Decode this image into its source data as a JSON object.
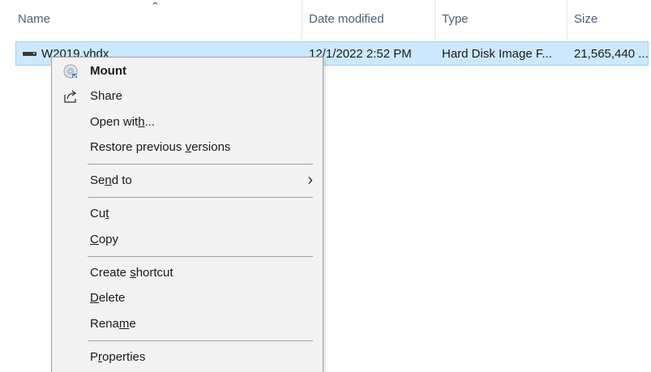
{
  "columns": {
    "name": "Name",
    "date_modified": "Date modified",
    "type": "Type",
    "size": "Size"
  },
  "file": {
    "name": "W2019.vhdx",
    "date_modified": "12/1/2022 2:52 PM",
    "type": "Hard Disk Image F...",
    "size": "21,565,440 ..."
  },
  "context_menu": {
    "mount": "Mount",
    "share": "Share",
    "open_with_pre": "Open wit",
    "open_with_u": "h",
    "open_with_post": "...",
    "restore_pre": "Restore previous ",
    "restore_u": "v",
    "restore_post": "ersions",
    "send_to_pre": "Se",
    "send_to_u": "n",
    "send_to_post": "d to",
    "cut_pre": "Cu",
    "cut_u": "t",
    "copy_u": "C",
    "copy_post": "opy",
    "create_shortcut_pre": "Create ",
    "create_shortcut_u": "s",
    "create_shortcut_post": "hortcut",
    "delete_u": "D",
    "delete_post": "elete",
    "rename_pre": "Rena",
    "rename_u": "m",
    "rename_post": "e",
    "properties_pre": "P",
    "properties_u": "r",
    "properties_post": "operties"
  },
  "icons": {
    "sort": "sort-up-caret",
    "file": "hard-disk-image-icon",
    "mount": "disc-mount-icon",
    "share": "share-icon",
    "submenu": "chevron-right-icon"
  },
  "colors": {
    "selection_bg": "#cce8ff",
    "selection_border": "#99d1ff",
    "menu_bg": "#f2f2f2",
    "header_text": "#4c607a"
  }
}
